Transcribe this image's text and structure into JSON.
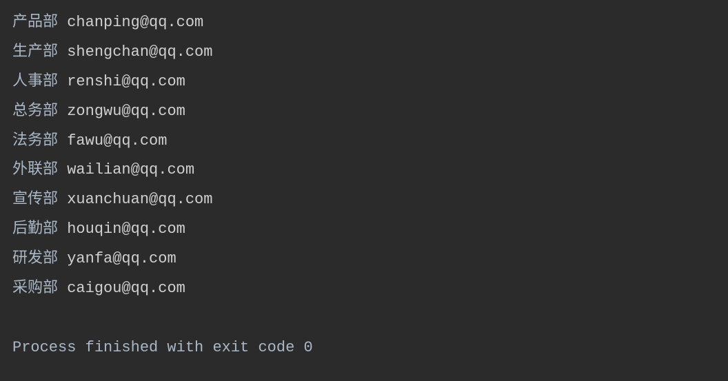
{
  "lines": [
    {
      "dept": "产品部",
      "email": "chanping@qq.com"
    },
    {
      "dept": "生产部",
      "email": "shengchan@qq.com"
    },
    {
      "dept": "人事部",
      "email": "renshi@qq.com"
    },
    {
      "dept": "总务部",
      "email": "zongwu@qq.com"
    },
    {
      "dept": "法务部",
      "email": "fawu@qq.com"
    },
    {
      "dept": "外联部",
      "email": "wailian@qq.com"
    },
    {
      "dept": "宣传部",
      "email": "xuanchuan@qq.com"
    },
    {
      "dept": "后勤部",
      "email": "houqin@qq.com"
    },
    {
      "dept": "研发部",
      "email": "yanfa@qq.com"
    },
    {
      "dept": "采购部",
      "email": "caigou@qq.com"
    }
  ],
  "status": "Process finished with exit code 0"
}
